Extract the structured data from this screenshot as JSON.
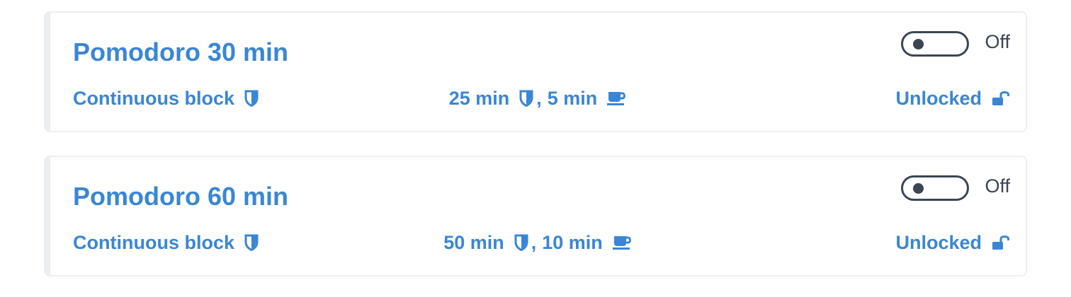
{
  "colors": {
    "accent": "#3a86d4",
    "dark": "#3b4554",
    "border": "#eceff2"
  },
  "cards": [
    {
      "title": "Pomodoro 30 min",
      "mode": "Continuous block",
      "focus": "25 min",
      "separator": ",",
      "break": "5 min",
      "lock_status": "Unlocked",
      "toggle_label": "Off",
      "toggle_on": false,
      "icons": {
        "mode": "shield-icon",
        "focus": "shield-icon",
        "break": "coffee-cup-icon",
        "lock": "unlock-icon"
      }
    },
    {
      "title": "Pomodoro 60 min",
      "mode": "Continuous block",
      "focus": "50 min",
      "separator": ",",
      "break": "10 min",
      "lock_status": "Unlocked",
      "toggle_label": "Off",
      "toggle_on": false,
      "icons": {
        "mode": "shield-icon",
        "focus": "shield-icon",
        "break": "coffee-cup-icon",
        "lock": "unlock-icon"
      }
    }
  ]
}
